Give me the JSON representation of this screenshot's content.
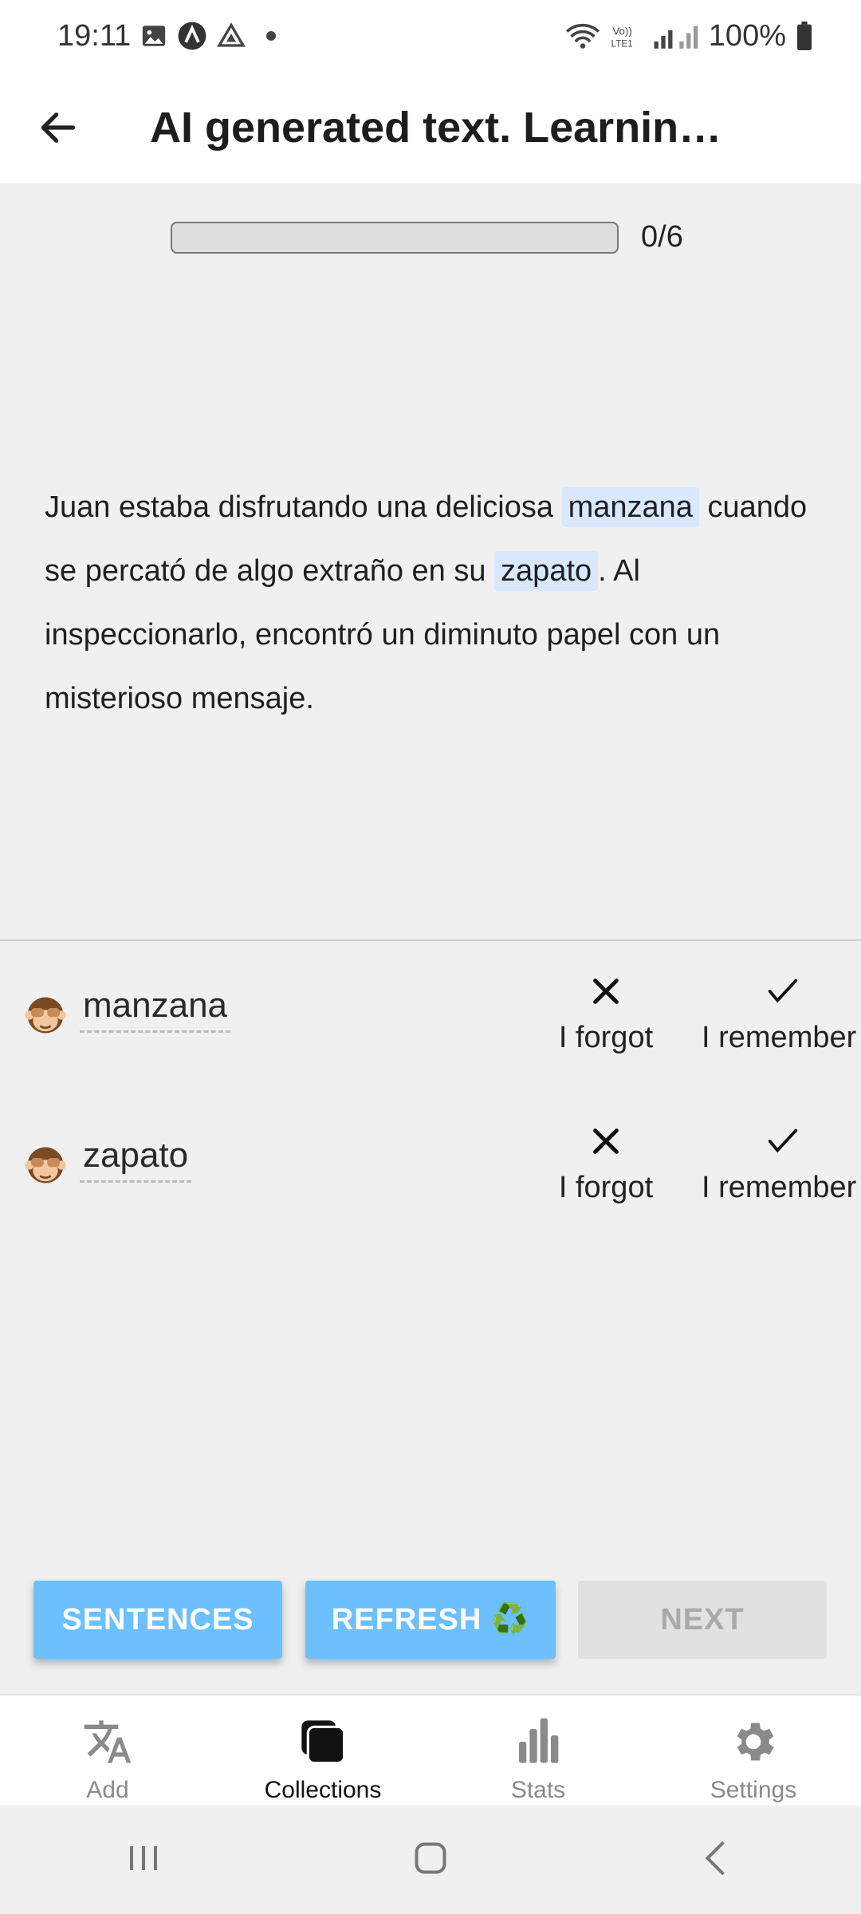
{
  "status_bar": {
    "time": "19:11",
    "battery": "100%",
    "icons": [
      "gallery-icon",
      "app-icon",
      "drive-icon",
      "wifi-icon",
      "volte-icon",
      "signal-icon",
      "battery-icon"
    ]
  },
  "app_bar": {
    "title": "AI generated text. Learnin…",
    "back_icon": "arrow-back-icon"
  },
  "progress": {
    "label": "0/6",
    "fraction": 0
  },
  "story": {
    "segments": [
      {
        "text": "Juan estaba disfrutando una deliciosa ",
        "highlight": false
      },
      {
        "text": "manzana",
        "highlight": true
      },
      {
        "text": " cuando se percató de algo extraño en su ",
        "highlight": false
      },
      {
        "text": "zapato",
        "highlight": true
      },
      {
        "text": ". Al inspeccionarlo, encontró un diminuto papel con un misterioso mensaje.",
        "highlight": false
      }
    ]
  },
  "words": [
    {
      "icon": "see-no-evil-monkey-icon",
      "word": "manzana",
      "forgot_label": "I forgot",
      "remember_label": "I remember"
    },
    {
      "icon": "see-no-evil-monkey-icon",
      "word": "zapato",
      "forgot_label": "I forgot",
      "remember_label": "I remember"
    }
  ],
  "buttons": {
    "sentences": "SENTENCES",
    "refresh": "REFRESH ♻️",
    "next": "NEXT"
  },
  "bottom_nav": [
    {
      "label": "Add",
      "icon": "translate-icon",
      "active": false
    },
    {
      "label": "Collections",
      "icon": "collections-icon",
      "active": true
    },
    {
      "label": "Stats",
      "icon": "bar-chart-icon",
      "active": false
    },
    {
      "label": "Settings",
      "icon": "gear-icon",
      "active": false
    }
  ],
  "colors": {
    "accent": "#6cc0ff",
    "highlight": "#d9e8ff",
    "background": "#f0f0f0"
  }
}
